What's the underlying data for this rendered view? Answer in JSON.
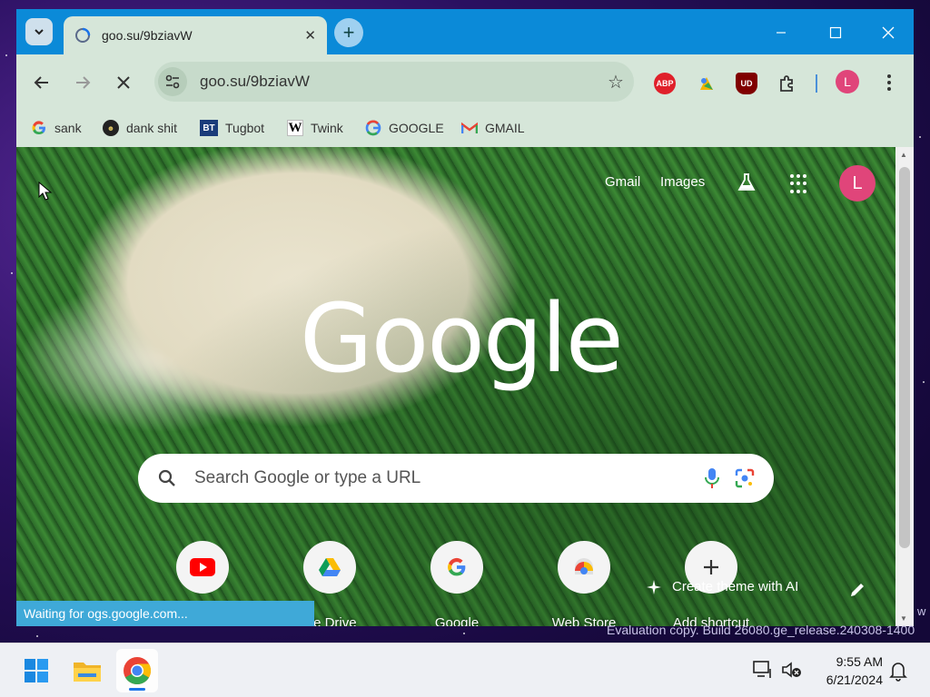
{
  "tab": {
    "title": "goo.su/9bziavW"
  },
  "toolbar": {
    "url": "goo.su/9bziavW",
    "profile_initial": "L",
    "ext_abp": "ABP",
    "ext_ublock": "UD"
  },
  "bookmarks": [
    {
      "label": "sank",
      "icon": "google-g-icon"
    },
    {
      "label": "dank shit",
      "icon": "dank-icon"
    },
    {
      "label": "Tugbot",
      "icon": "bt-icon",
      "badge": "BT"
    },
    {
      "label": "Twink",
      "icon": "w-icon",
      "badge": "W"
    },
    {
      "label": "GOOGLE",
      "icon": "google-g-icon"
    },
    {
      "label": "GMAIL",
      "icon": "gmail-icon"
    }
  ],
  "ntp": {
    "links": {
      "gmail": "Gmail",
      "images": "Images"
    },
    "profile_initial": "L",
    "logo": "Google",
    "search_placeholder": "Search Google or type a URL",
    "shortcuts": [
      {
        "label": "",
        "icon": "youtube-icon"
      },
      {
        "label": "gle Drive",
        "icon": "drive-icon"
      },
      {
        "label": "Google",
        "icon": "google-g-icon"
      },
      {
        "label": "Web Store",
        "icon": "webstore-icon"
      },
      {
        "label": "Add shortcut",
        "icon": "plus-icon"
      }
    ],
    "theme_button": "Create theme with AI"
  },
  "status_bar": "Waiting for ogs.google.com...",
  "watermark": "Evaluation copy. Build 26080.ge_release.240308-1400",
  "watermark_edge": "w",
  "taskbar": {
    "time": "9:55 AM",
    "date": "6/21/2024"
  },
  "colors": {
    "accent": "#0b8ad8",
    "chrome_bar": "#d6e6d9",
    "avatar": "#e0457a",
    "status_bar": "#3fa9d8"
  }
}
